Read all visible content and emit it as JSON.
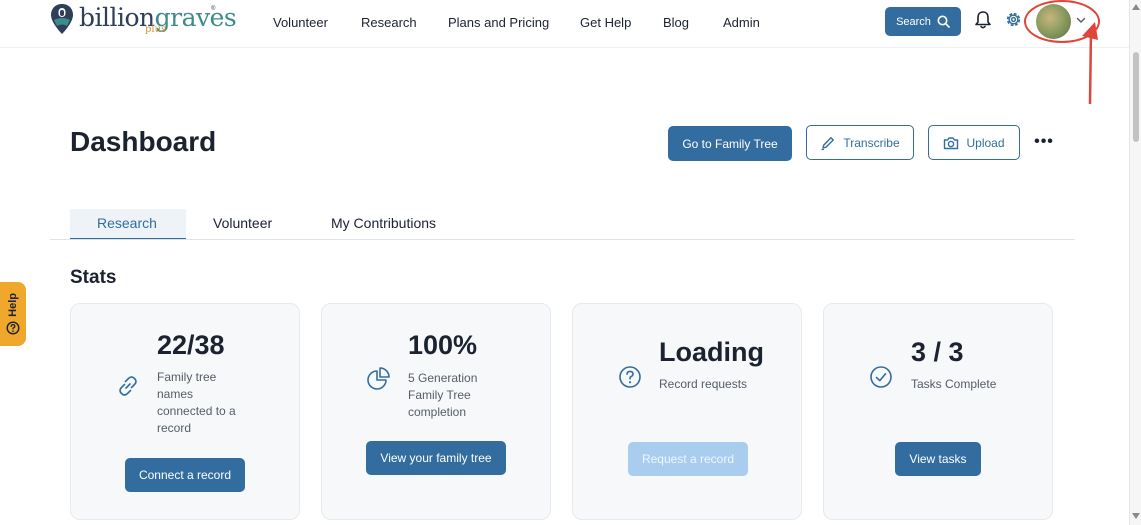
{
  "brand": {
    "name_part1": "billion",
    "name_part2": "graves",
    "suffix": "plus",
    "reg_mark": "®"
  },
  "nav": {
    "items": [
      "Volunteer",
      "Research",
      "Plans and Pricing",
      "Get Help",
      "Blog",
      "Admin"
    ],
    "search_label": "Search"
  },
  "icons": {
    "search": "search-icon",
    "bell": "bell-icon",
    "gear": "gear-icon",
    "chevron": "chevron-down-icon",
    "pencil": "pencil-icon",
    "camera": "camera-icon",
    "more": "more-horizontal-icon",
    "link": "link-icon",
    "pie": "pie-chart-icon",
    "question": "question-circle-icon",
    "check": "check-circle-icon",
    "help": "help-circle-icon"
  },
  "colors": {
    "primary": "#336d9f",
    "help_tab": "#f0a82c",
    "highlight": "#e0443a",
    "disabled": "#a9cdef"
  },
  "help_tab": {
    "label": "Help"
  },
  "header": {
    "title": "Dashboard",
    "go_family_tree": "Go to Family Tree",
    "transcribe": "Transcribe",
    "upload": "Upload",
    "more": "•••"
  },
  "tabs": [
    "Research",
    "Volunteer",
    "My Contributions"
  ],
  "stats": {
    "heading": "Stats",
    "cards": [
      {
        "value": "22/38",
        "desc_lines": [
          "Family tree",
          "names",
          "connected to a",
          "record"
        ],
        "button": "Connect a record",
        "button_enabled": true
      },
      {
        "value": "100%",
        "desc_lines": [
          "5 Generation",
          "Family Tree",
          "completion"
        ],
        "button": "View your family tree",
        "button_enabled": true
      },
      {
        "value": "Loading",
        "desc_lines": [
          "Record requests"
        ],
        "button": "Request a record",
        "button_enabled": false
      },
      {
        "value": "3 / 3",
        "desc_lines": [
          "Tasks Complete"
        ],
        "button": "View tasks",
        "button_enabled": true
      }
    ]
  }
}
